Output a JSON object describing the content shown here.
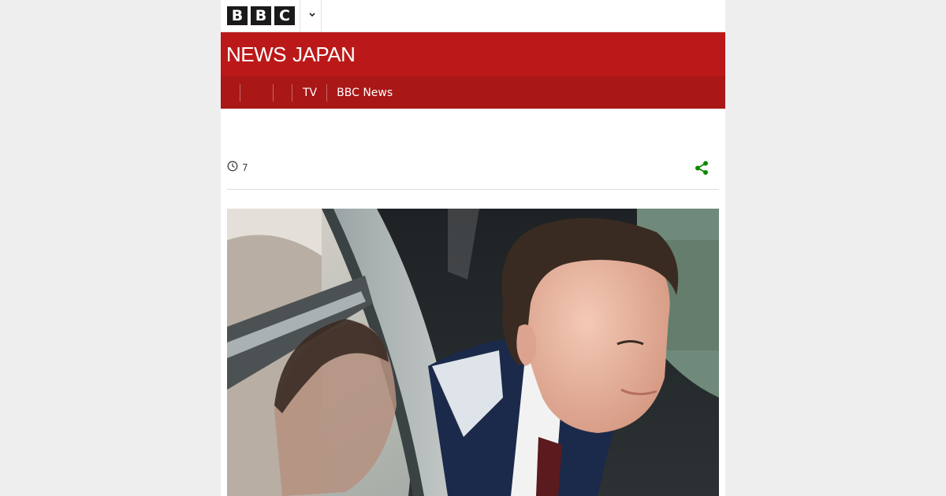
{
  "header": {
    "logo_letters": [
      "B",
      "B",
      "C"
    ],
    "more_icon": "chevron-down-icon"
  },
  "masthead": {
    "brand_news": "NEWS",
    "brand_edition": "JAPAN",
    "background": "#bb1919"
  },
  "nav": {
    "items": [
      {
        "label": ""
      },
      {
        "label": ""
      },
      {
        "label": "TV"
      },
      {
        "label": "BBC News"
      }
    ],
    "background": "#a91717"
  },
  "article": {
    "timestamp_icon": "clock-icon",
    "timestamp": "7",
    "share_icon": "share-icon",
    "share_color": "#0b8a00"
  },
  "image": {
    "description_icon": "photo"
  }
}
